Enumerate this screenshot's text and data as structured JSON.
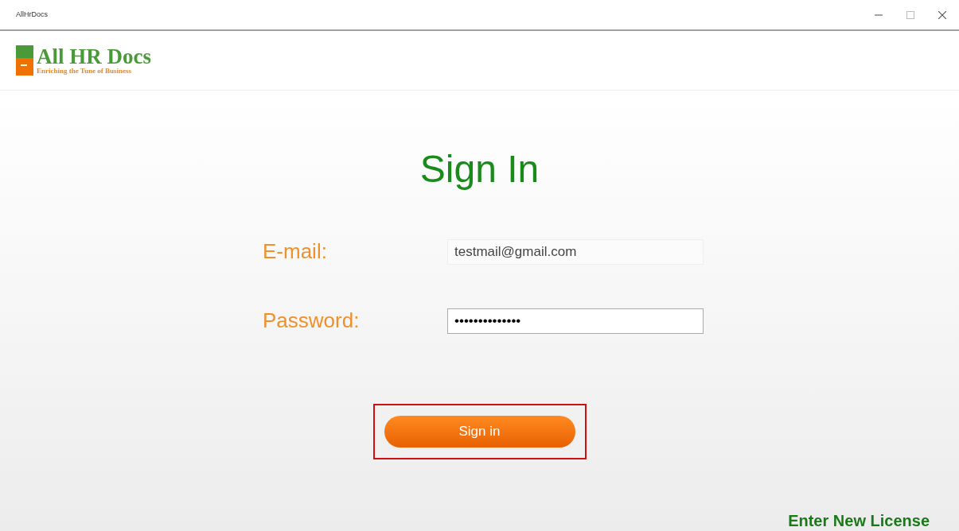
{
  "window": {
    "title": "AllHrDocs"
  },
  "logo": {
    "name": "All HR Docs",
    "tagline": "Enriching the Tune of Business"
  },
  "heading": "Sign In",
  "fields": [
    {
      "label": "E-mail:",
      "value": "testmail@gmail.com",
      "focused": false
    },
    {
      "label": "Password:",
      "value": "••••••••••••••",
      "focused": true
    }
  ],
  "sign_in_button": {
    "label": "Sign in",
    "highlighted": true
  },
  "license_link": "Enter New License"
}
